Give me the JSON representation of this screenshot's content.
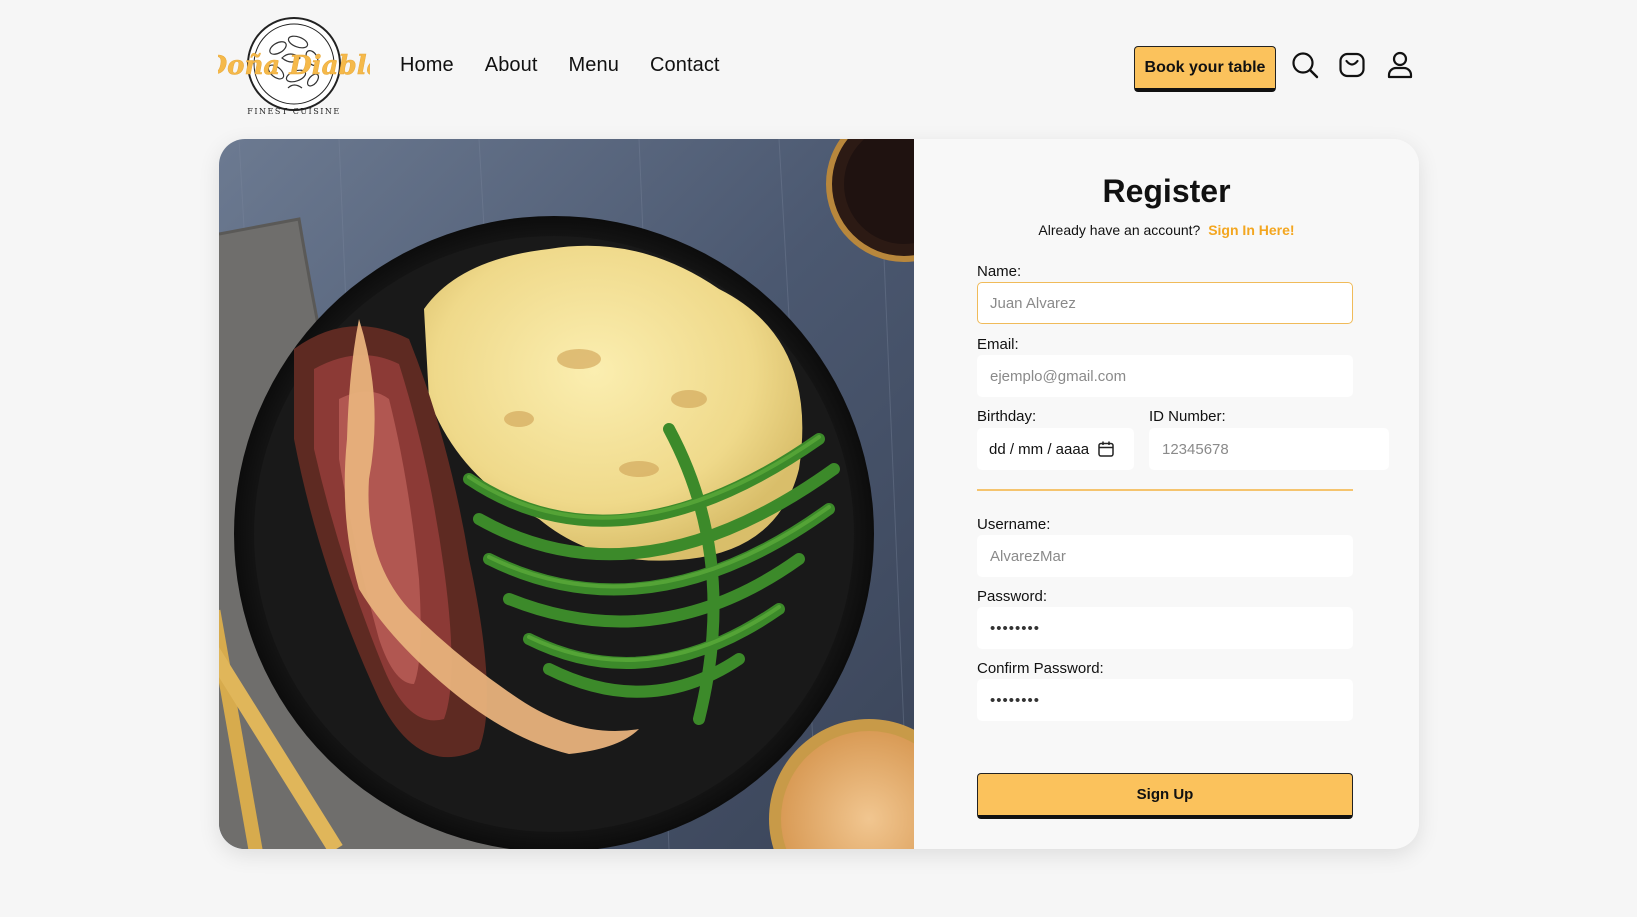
{
  "brand": {
    "logo_text": "Doña Diabla",
    "logo_tagline": "FINEST CUISINE",
    "accent": "#fbc25c"
  },
  "nav": {
    "items": [
      {
        "label": "Home"
      },
      {
        "label": "About"
      },
      {
        "label": "Menu"
      },
      {
        "label": "Contact"
      }
    ]
  },
  "header": {
    "book_label": "Book your table",
    "icons": [
      "search-icon",
      "cart-icon",
      "user-icon"
    ]
  },
  "hero_image": {
    "description_icon": "food-plate-image"
  },
  "register": {
    "title": "Register",
    "already_text": "Already have an account?",
    "signin_link": "Sign In Here!",
    "name": {
      "label": "Name:",
      "placeholder": "Juan Alvarez"
    },
    "email": {
      "label": "Email:",
      "placeholder": "ejemplo@gmail.com"
    },
    "birthday": {
      "label": "Birthday:",
      "value": "dd / mm / aaaa"
    },
    "id_number": {
      "label": "ID Number:",
      "placeholder": "12345678"
    },
    "username": {
      "label": "Username:",
      "placeholder": "AlvarezMar"
    },
    "password": {
      "label": "Password:",
      "value": "••••••••"
    },
    "confirm_password": {
      "label": "Confirm Password:",
      "value": "••••••••"
    },
    "submit_label": "Sign Up"
  }
}
